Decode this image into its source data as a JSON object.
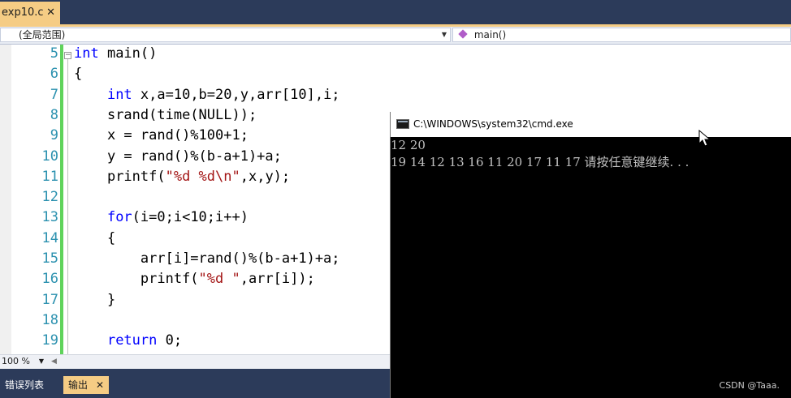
{
  "editor_tab": {
    "filename": "exp10.c",
    "close": "✕"
  },
  "nav": {
    "scope": "(全局范围)",
    "member": "main()"
  },
  "line_numbers": [
    "5",
    "6",
    "7",
    "8",
    "9",
    "10",
    "11",
    "12",
    "13",
    "14",
    "15",
    "16",
    "17",
    "18",
    "19"
  ],
  "code": [
    {
      "indent": "",
      "parts": [
        {
          "t": "int",
          "c": "kw"
        },
        {
          "t": " main()",
          "c": ""
        }
      ]
    },
    {
      "indent": "",
      "parts": [
        {
          "t": "{",
          "c": ""
        }
      ]
    },
    {
      "indent": "    ",
      "parts": [
        {
          "t": "int",
          "c": "kw"
        },
        {
          "t": " x,a=10,b=20,y,arr[10],i;",
          "c": ""
        }
      ]
    },
    {
      "indent": "    ",
      "parts": [
        {
          "t": "srand(time(NULL));",
          "c": ""
        }
      ]
    },
    {
      "indent": "    ",
      "parts": [
        {
          "t": "x = rand()%100+1;",
          "c": ""
        }
      ]
    },
    {
      "indent": "    ",
      "parts": [
        {
          "t": "y = rand()%(b-a+1)+a;",
          "c": ""
        }
      ]
    },
    {
      "indent": "    ",
      "parts": [
        {
          "t": "printf(",
          "c": ""
        },
        {
          "t": "\"%d %d\\n\"",
          "c": "str"
        },
        {
          "t": ",x,y);",
          "c": ""
        }
      ]
    },
    {
      "indent": "",
      "parts": []
    },
    {
      "indent": "    ",
      "parts": [
        {
          "t": "for",
          "c": "kw"
        },
        {
          "t": "(i=0;i<10;i++)",
          "c": ""
        }
      ]
    },
    {
      "indent": "    ",
      "parts": [
        {
          "t": "{",
          "c": ""
        }
      ]
    },
    {
      "indent": "        ",
      "parts": [
        {
          "t": "arr[i]=rand()%(b-a+1)+a;",
          "c": ""
        }
      ]
    },
    {
      "indent": "        ",
      "parts": [
        {
          "t": "printf(",
          "c": ""
        },
        {
          "t": "\"%d \"",
          "c": "str"
        },
        {
          "t": ",arr[i]);",
          "c": ""
        }
      ]
    },
    {
      "indent": "    ",
      "parts": [
        {
          "t": "}",
          "c": ""
        }
      ]
    },
    {
      "indent": "",
      "parts": []
    },
    {
      "indent": "    ",
      "parts": [
        {
          "t": "return",
          "c": "kw"
        },
        {
          "t": " 0;",
          "c": ""
        }
      ]
    }
  ],
  "zoom": {
    "level": "100 %"
  },
  "panel_tabs": {
    "errors": "错误列表",
    "output": "输出",
    "close": "✕"
  },
  "console": {
    "title": "C:\\WINDOWS\\system32\\cmd.exe",
    "lines": [
      "12 20",
      "19 14 12 13 16 11 20 17 11 17 请按任意键继续. . ."
    ]
  },
  "watermark": "CSDN @Taaa.",
  "colors": {
    "keyword": "#0000ff",
    "string": "#a31515",
    "line_number": "#2b91af",
    "tab_active": "#f5cc84",
    "chrome": "#2c3b5a",
    "change_bar": "#5fd35b"
  }
}
